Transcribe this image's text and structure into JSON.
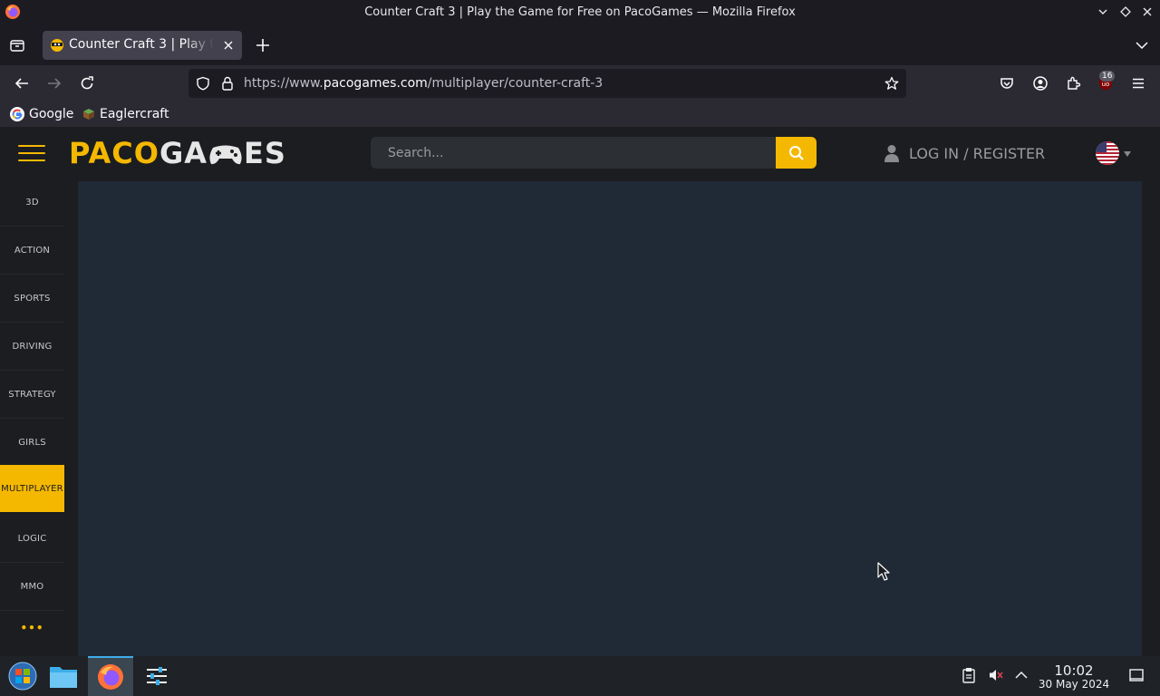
{
  "window": {
    "title": "Counter Craft 3 | Play the Game for Free on PacoGames — Mozilla Firefox"
  },
  "tabs": [
    {
      "title": "Counter Craft 3 | Play the Game for Free on PacoGames",
      "active": true
    }
  ],
  "navbar": {
    "url_prefix": "https://www.",
    "url_host": "pacogames.com",
    "url_path": "/multiplayer/counter-craft-3",
    "extension_badge": "16"
  },
  "bookmarks": [
    {
      "label": "Google",
      "icon": "google-icon"
    },
    {
      "label": "Eaglercraft",
      "icon": "eaglercraft-icon"
    }
  ],
  "site": {
    "logo_part1": "PACO",
    "logo_part2": "GA",
    "logo_part3": "ES",
    "search_placeholder": "Search...",
    "login_label": "LOG IN / REGISTER",
    "language": "us-flag-icon",
    "accent_color": "#f5b800",
    "categories": [
      {
        "label": "3D",
        "active": false
      },
      {
        "label": "ACTION",
        "active": false
      },
      {
        "label": "SPORTS",
        "active": false
      },
      {
        "label": "DRIVING",
        "active": false
      },
      {
        "label": "STRATEGY",
        "active": false
      },
      {
        "label": "GIRLS",
        "active": false
      },
      {
        "label": "MULTIPLAYER",
        "active": true
      },
      {
        "label": "LOGIC",
        "active": false
      },
      {
        "label": "MMO",
        "active": false
      }
    ],
    "more_label": "•••"
  },
  "taskbar": {
    "time": "10:02",
    "date": "30 May 2024"
  }
}
